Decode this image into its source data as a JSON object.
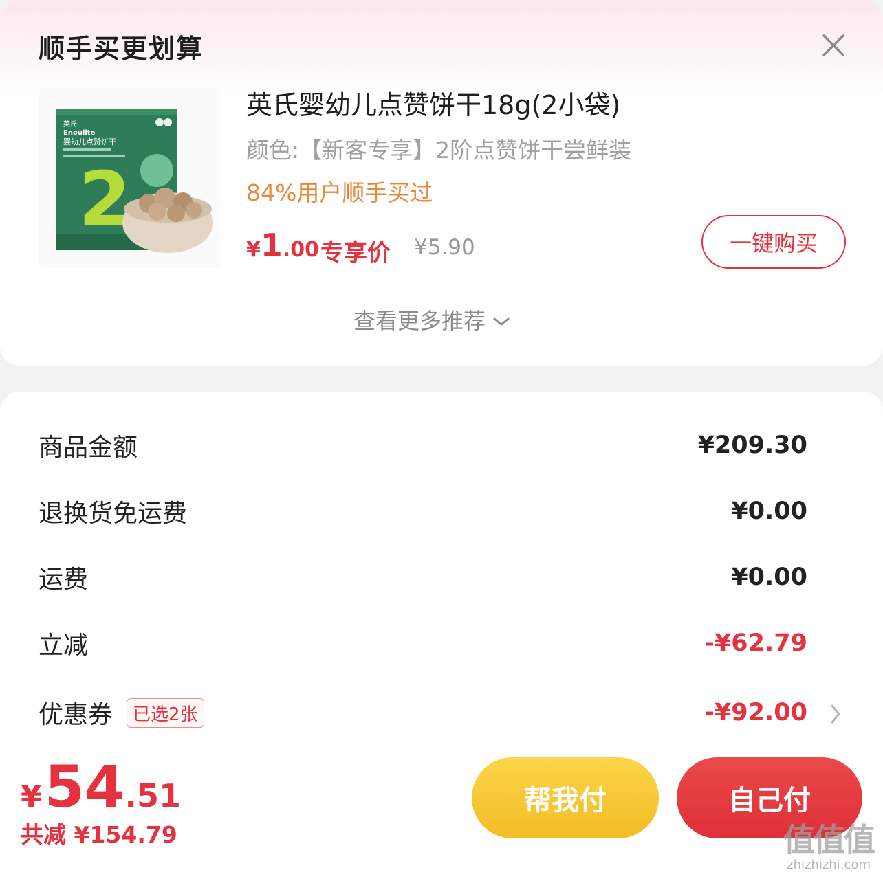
{
  "panel": {
    "title": "顺手买更划算"
  },
  "product": {
    "name": "英氏婴幼儿点赞饼干18g(2小袋)",
    "spec": "颜色:【新客专享】2阶点赞饼干尝鲜装",
    "hint": "84%用户顺手买过",
    "price_symbol": "¥",
    "price_int": "1",
    "price_dec": ".00",
    "price_label": "专享价",
    "original_price": "¥5.90",
    "buy_button": "一键购买",
    "image": {
      "brand_cn": "英氏",
      "brand_en": "Enoulite",
      "box_title": "婴幼儿点赞饼干",
      "stage": "2"
    }
  },
  "more_recommend": "查看更多推荐",
  "summary": {
    "rows": [
      {
        "label": "商品金额",
        "value": "¥209.30"
      },
      {
        "label": "退换货免运费",
        "value": "¥0.00"
      },
      {
        "label": "运费",
        "value": "¥0.00"
      },
      {
        "label": "立减",
        "value": "-¥62.79"
      },
      {
        "label": "优惠券",
        "badge": "已选2张",
        "value": "-¥92.00"
      }
    ]
  },
  "footer": {
    "total_symbol": "¥",
    "total_int": "54",
    "total_dec": ".51",
    "saved": "共减 ¥154.79",
    "help_pay": "帮我付",
    "self_pay": "自己付"
  },
  "watermark": {
    "logo": "值值值",
    "url": "zhizhizhi.com"
  },
  "colors": {
    "accent_red": "#e5323e",
    "hint_orange": "#e8883a",
    "help_yellow": "#f3bd25"
  }
}
